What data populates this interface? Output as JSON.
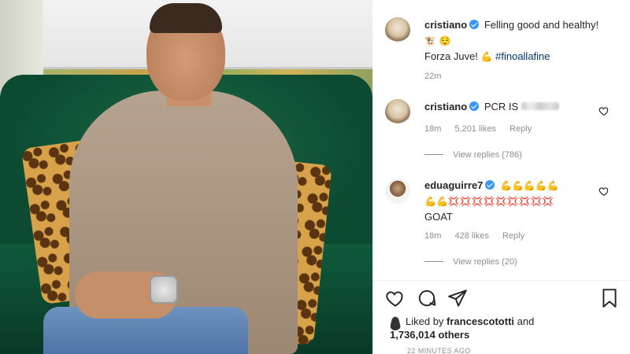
{
  "post": {
    "photo_alt": "",
    "caption": {
      "username": "cristiano",
      "text_line1": "Felling good and healthy!",
      "text_line2": "Forza Juve!",
      "hashtag": "#finoallafine",
      "age": "22m"
    }
  },
  "comments": [
    {
      "username": "cristiano",
      "text": "PCR IS",
      "age": "18m",
      "likes": "5,201 likes",
      "reply_label": "Reply",
      "view_replies": "View replies (786)"
    },
    {
      "username": "eduaguirre7",
      "line2_text": "GOAT",
      "age": "18m",
      "likes": "428 likes",
      "reply_label": "Reply",
      "view_replies": "View replies (20)"
    }
  ],
  "footer": {
    "liked_by_prefix": "Liked by",
    "liked_by_user": "francescototti",
    "liked_by_and": "and",
    "others": "1,736,014 others",
    "timestamp": "22 MINUTES AGO"
  },
  "icons": {
    "heart": "heart-icon",
    "comment": "comment-icon",
    "share": "share-icon",
    "save": "bookmark-icon",
    "verified": "verified-badge-icon"
  },
  "colors": {
    "verified": "#3897f0",
    "muted": "#8e8e8e",
    "hashtag": "#00376b"
  }
}
